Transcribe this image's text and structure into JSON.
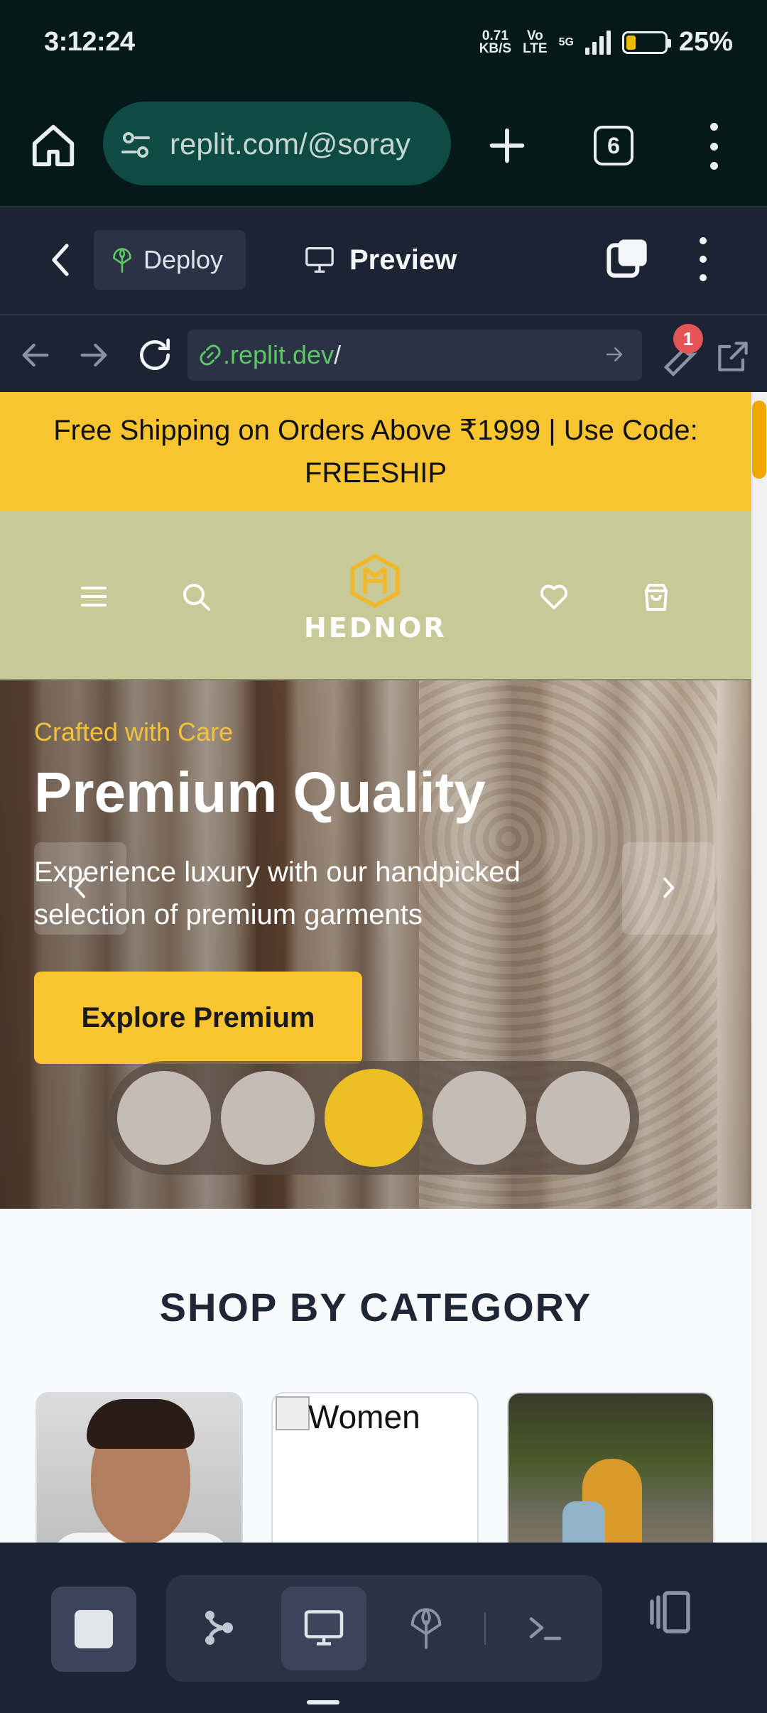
{
  "status_bar": {
    "time": "3:12:24",
    "net_speed_value": "0.71",
    "net_speed_unit": "KB/S",
    "volte_top": "Vo",
    "volte_bottom": "LTE",
    "signal_type": "5G",
    "battery_percent": "25%",
    "battery_level": 0.25,
    "battery_color": "#f0b800"
  },
  "browser": {
    "url": "replit.com/@soray",
    "tab_count": "6",
    "icons": [
      "home-icon",
      "site-settings-icon",
      "new-tab-icon",
      "tabs-icon",
      "more-vert-icon"
    ]
  },
  "replit_header": {
    "deploy_label": "Deploy",
    "preview_label": "Preview"
  },
  "preview_nav": {
    "url_host": ".replit.dev",
    "url_path": "/",
    "devtools_badge": "1",
    "accent_green": "#5cc864"
  },
  "site": {
    "promo_line1": "Free Shipping on Orders Above ₹1999 | Use Code:",
    "promo_line2": "FREESHIP",
    "brand": "HEDNOR",
    "hero": {
      "kicker": "Crafted with Care",
      "title": "Premium Quality",
      "subtitle": "Experience luxury with our handpicked selection of premium garments",
      "cta": "Explore Premium",
      "slide_count": 5,
      "active_slide": 3
    },
    "section_title": "SHOP BY CATEGORY",
    "categories": [
      {
        "alt": "Men"
      },
      {
        "alt": "Women"
      },
      {
        "alt": "Kids"
      }
    ],
    "brand_yellow": "#f8c531",
    "header_bg": "#c7c997"
  },
  "bottom_toolbar": {
    "icons": [
      "stop-icon",
      "git-icon",
      "preview-icon",
      "deploy-icon",
      "shell-icon",
      "panels-icon"
    ],
    "active": "preview-icon"
  }
}
